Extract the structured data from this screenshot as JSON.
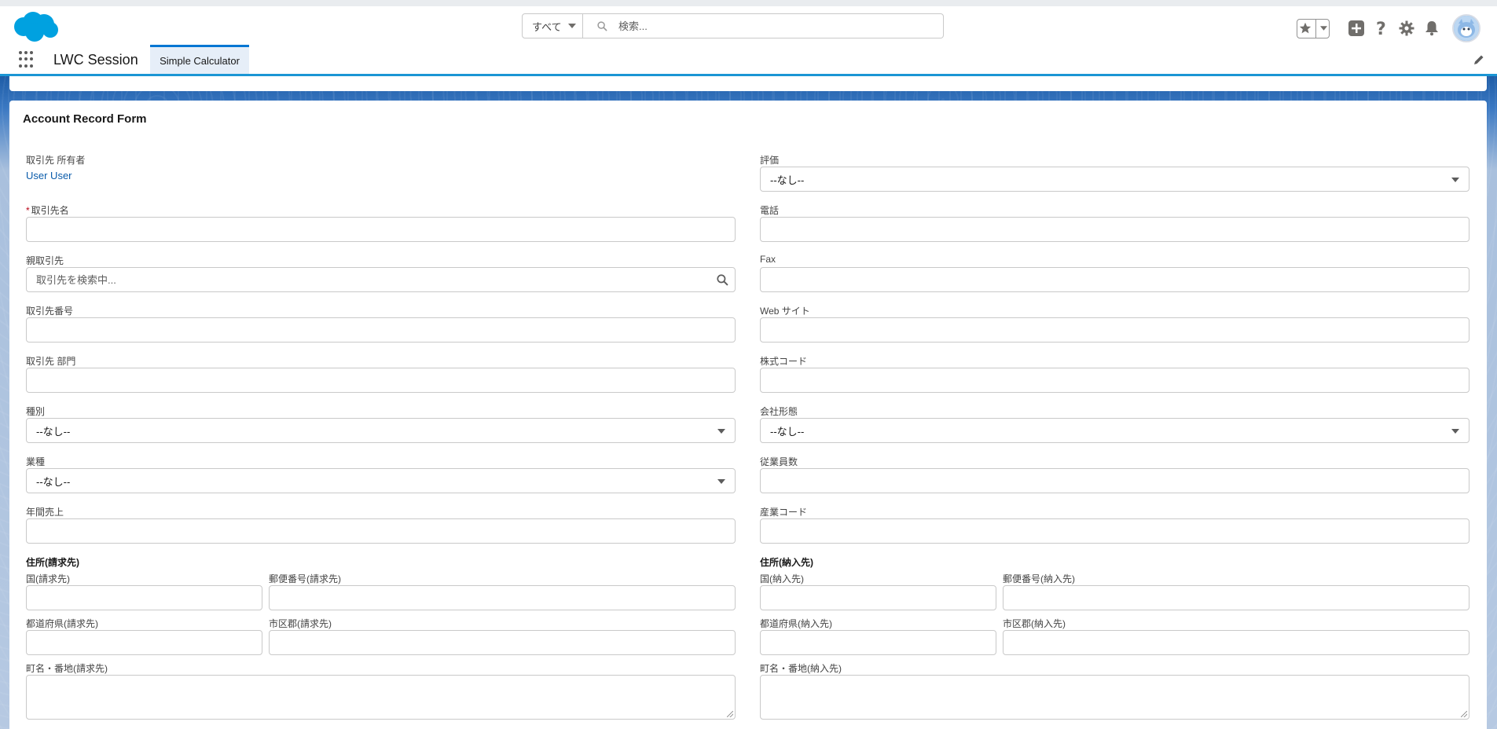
{
  "header": {
    "search_scope": "すべて",
    "search_placeholder": "検索...",
    "icons": [
      "salesforce-cloud-logo",
      "star-icon",
      "plus-icon",
      "help-icon",
      "gear-icon",
      "bell-icon",
      "avatar"
    ]
  },
  "nav": {
    "app_name": "LWC Session",
    "tabs": [
      {
        "label": "Simple Calculator",
        "active": true
      }
    ]
  },
  "form": {
    "title": "Account Record Form",
    "left": {
      "owner_label": "取引先 所有者",
      "owner_value": "User User",
      "account_name_required": "*",
      "account_name_label": "取引先名",
      "parent_label": "親取引先",
      "parent_placeholder": "取引先を検索中...",
      "account_number_label": "取引先番号",
      "division_label": "取引先 部門",
      "type_label": "種別",
      "type_value": "--なし--",
      "industry_label": "業種",
      "industry_value": "--なし--",
      "revenue_label": "年間売上",
      "billing_section": "住所(請求先)",
      "billing_country": "国(請求先)",
      "billing_postal": "郵便番号(請求先)",
      "billing_state": "都道府県(請求先)",
      "billing_city": "市区郡(請求先)",
      "billing_street": "町名・番地(請求先)"
    },
    "right": {
      "rating_label": "評価",
      "rating_value": "--なし--",
      "phone_label": "電話",
      "fax_label": "Fax",
      "website_label": "Web サイト",
      "ticker_label": "株式コード",
      "ownership_label": "会社形態",
      "ownership_value": "--なし--",
      "employees_label": "従業員数",
      "sic_label": "産業コード",
      "shipping_section": "住所(納入先)",
      "shipping_country": "国(納入先)",
      "shipping_postal": "郵便番号(納入先)",
      "shipping_state": "都道府県(納入先)",
      "shipping_city": "市区郡(納入先)",
      "shipping_street": "町名・番地(納入先)"
    }
  },
  "colors": {
    "brand_blue": "#0176d3",
    "link": "#0b5cab",
    "required": "#ba0517"
  }
}
